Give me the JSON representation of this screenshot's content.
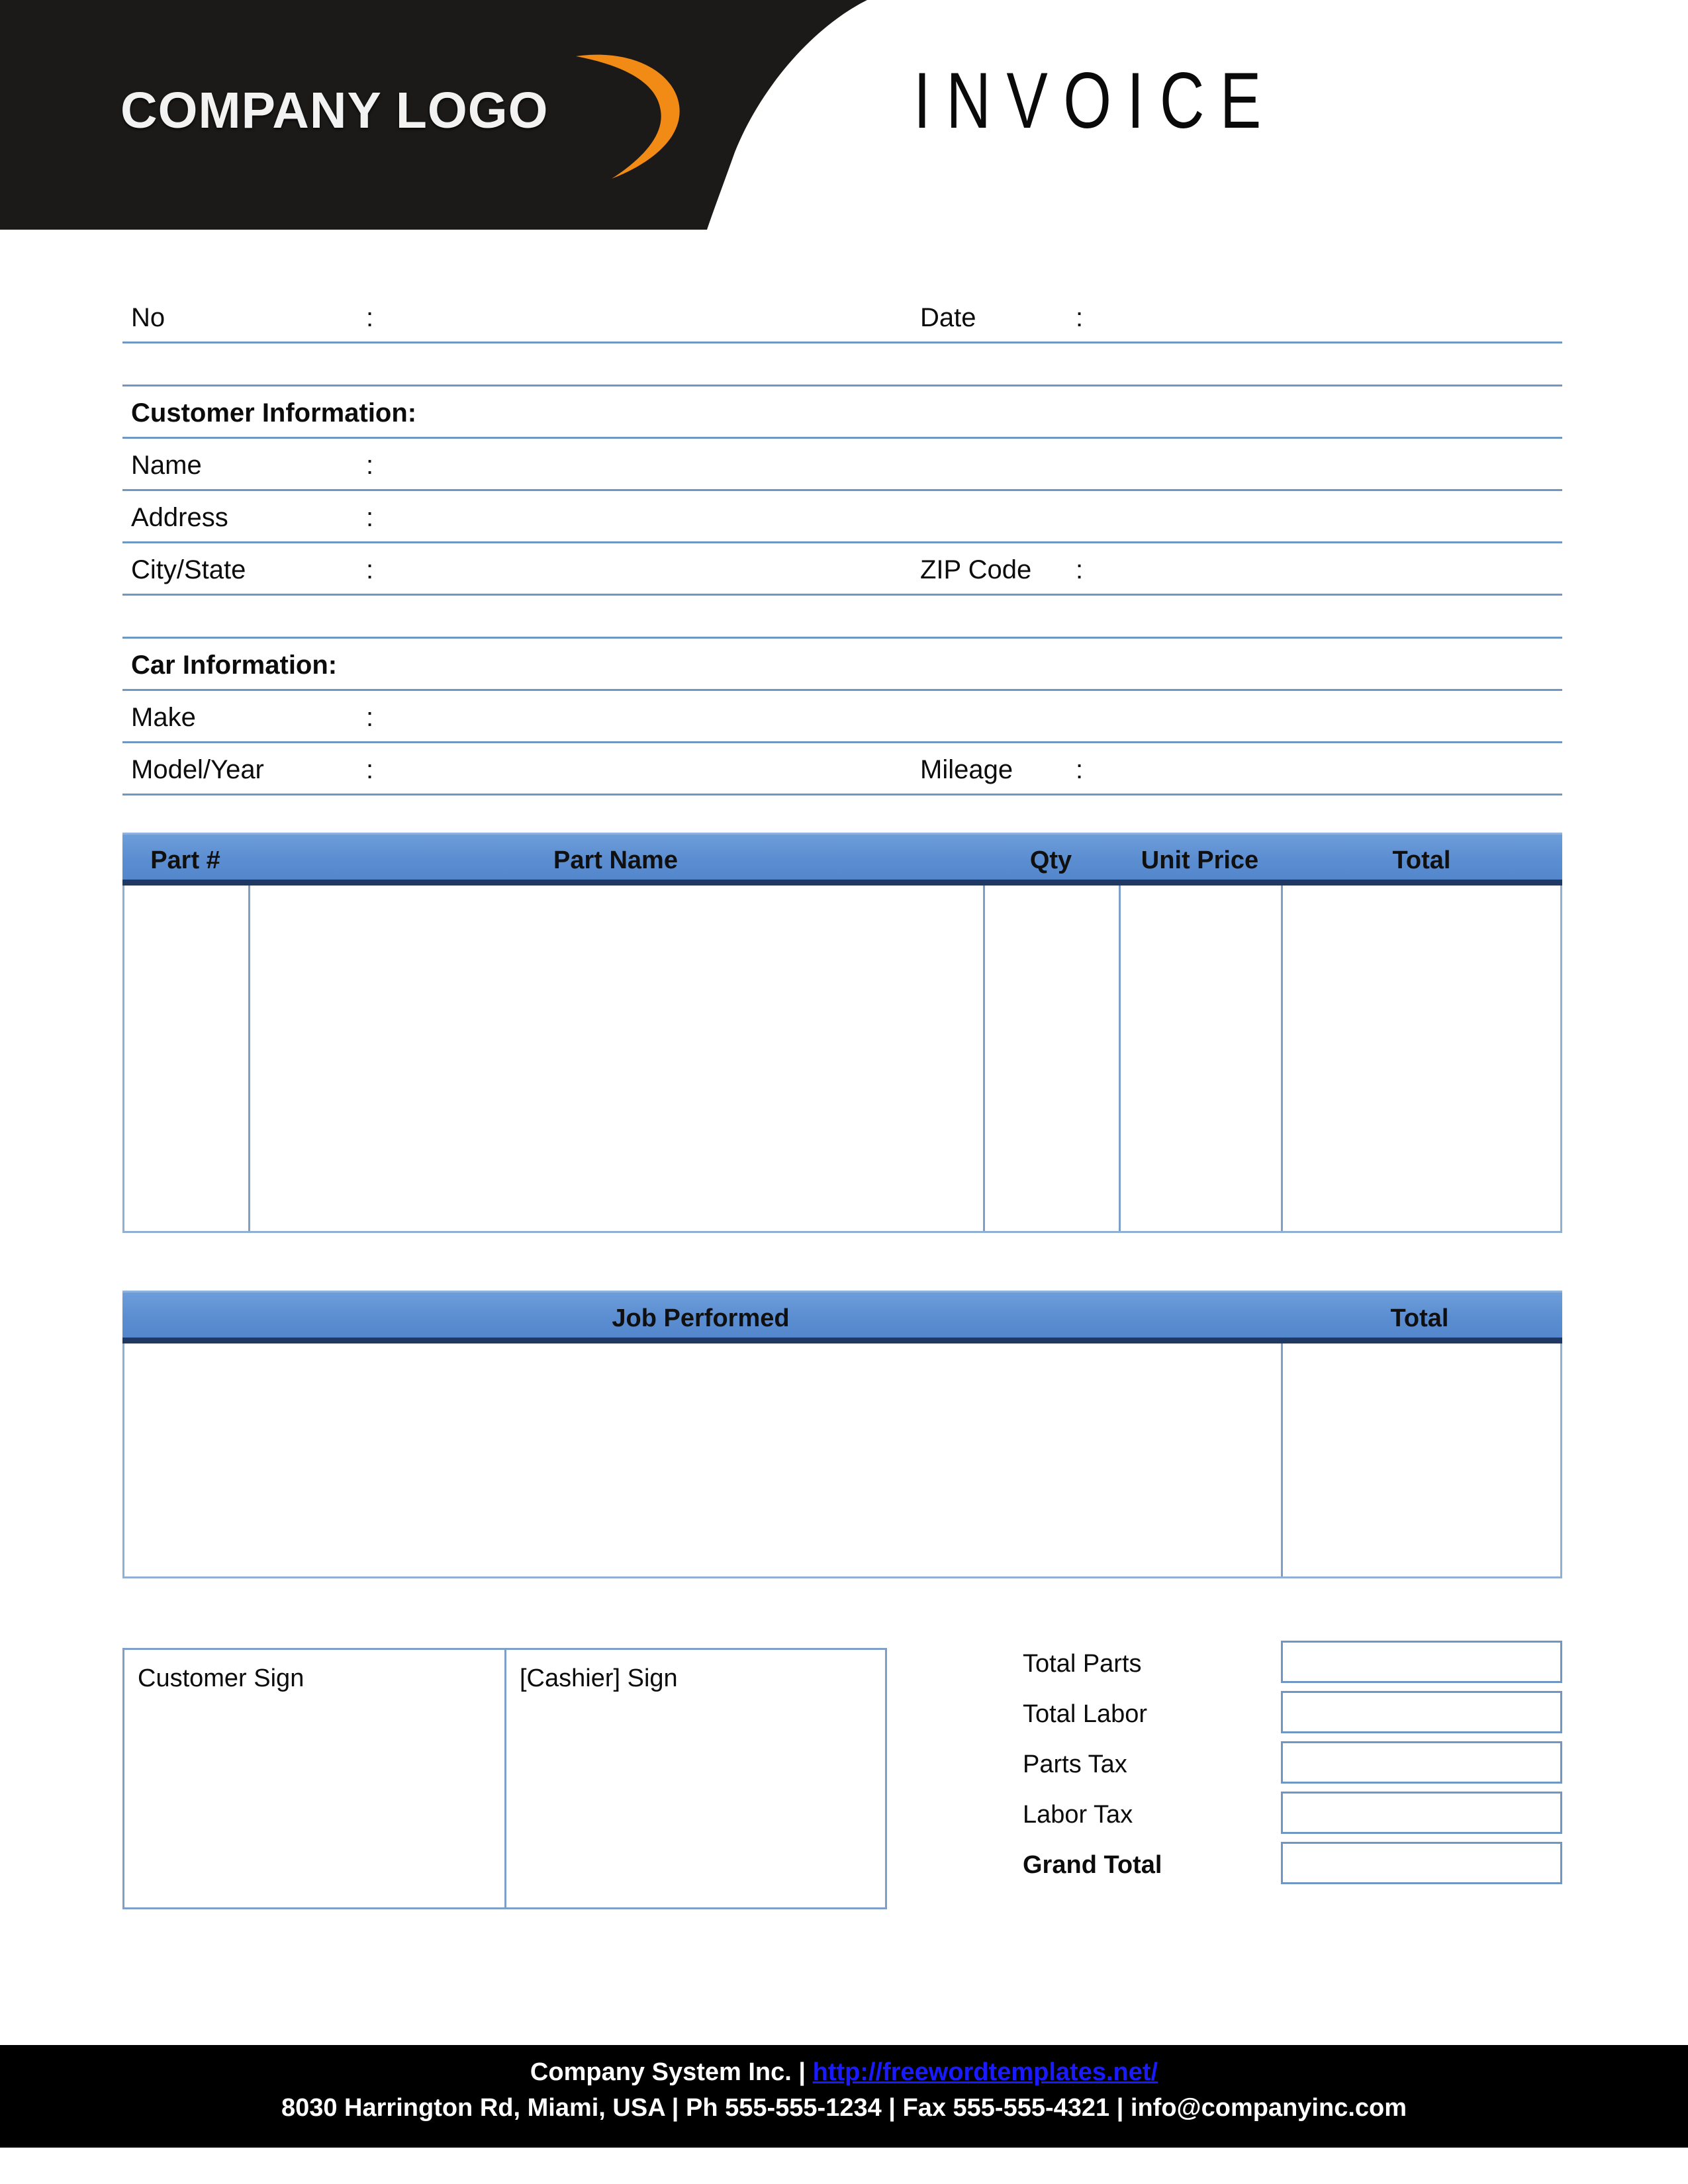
{
  "header": {
    "logo_text": "COMPANY LOGO",
    "logo_swoosh_color": "#F28A16",
    "band_color": "#1C1A18",
    "title": "INVOICE"
  },
  "meta_fields": {
    "no_label": "No",
    "no_colon": ":",
    "date_label": "Date",
    "date_colon": ":"
  },
  "customer": {
    "section_title": "Customer Information:",
    "fields": [
      {
        "label": "Name",
        "colon": ":"
      },
      {
        "label": "Address",
        "colon": ":"
      },
      {
        "label": "City/State",
        "colon": ":",
        "label2": "ZIP Code",
        "colon2": ":"
      }
    ]
  },
  "car": {
    "section_title": "Car Information:",
    "fields": [
      {
        "label": "Make",
        "colon": ":"
      },
      {
        "label": "Model/Year",
        "colon": ":",
        "label2": "Mileage",
        "colon2": ":"
      }
    ]
  },
  "parts_table": {
    "header_bg": "#5B8ED1",
    "header_border": "#1F3864",
    "columns": [
      {
        "label": "Part #"
      },
      {
        "label": "Part Name"
      },
      {
        "label": "Qty"
      },
      {
        "label": "Unit Price"
      },
      {
        "label": "Total"
      }
    ],
    "rows": []
  },
  "job_table": {
    "header_bg": "#5B8ED1",
    "columns": [
      {
        "label": "Job Performed"
      },
      {
        "label": "Total"
      }
    ],
    "rows": []
  },
  "signatures": {
    "customer_sign_label": "Customer Sign",
    "cashier_sign_label": "[Cashier] Sign"
  },
  "totals": {
    "rows": [
      {
        "label": "Total Parts",
        "value": "",
        "bold": false
      },
      {
        "label": "Total Labor",
        "value": "",
        "bold": false
      },
      {
        "label": "Parts Tax",
        "value": "",
        "bold": false
      },
      {
        "label": "Labor Tax",
        "value": "",
        "bold": false
      },
      {
        "label": "Grand Total",
        "value": "",
        "bold": true
      }
    ]
  },
  "footer": {
    "company_name": "Company System Inc. | ",
    "url": "http://freewordtemplates.net/",
    "address_line": "8030 Harrington Rd, Miami, USA | Ph 555-555-1234 | Fax 555-555-4321 | info@companyinc.com",
    "link_color": "#1A1AFF",
    "bg_color": "#000000"
  }
}
